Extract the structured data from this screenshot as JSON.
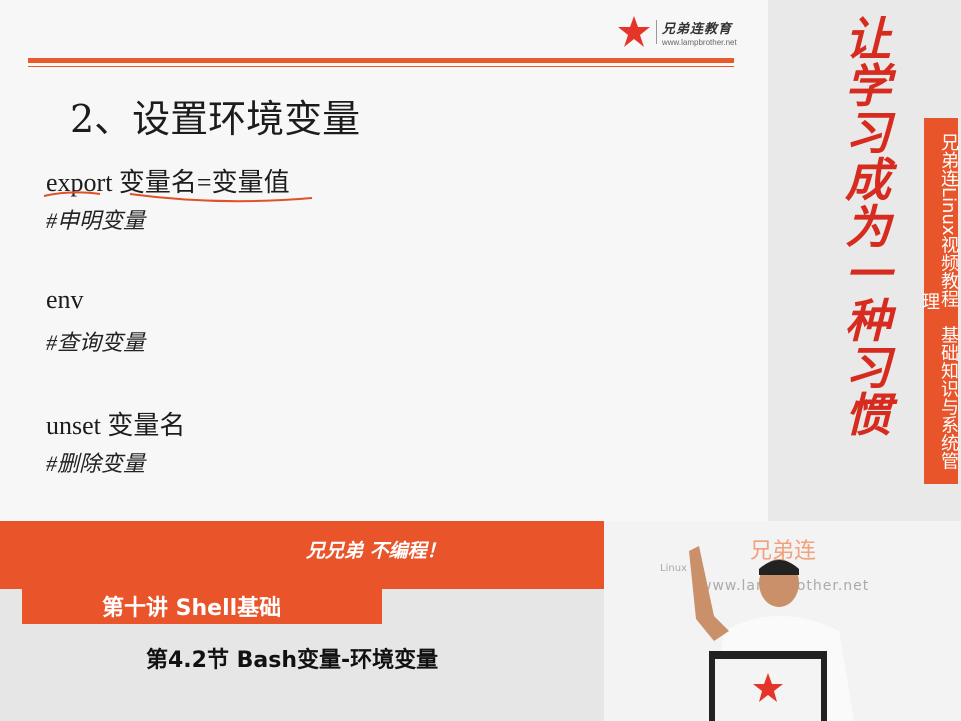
{
  "slide": {
    "logo": {
      "name": "兄弟连教育",
      "url": "www.lampbrother.net"
    },
    "title": "2、设置环境变量",
    "items": [
      {
        "command": "export 变量名=变量值",
        "comment": "#申明变量"
      },
      {
        "command": "env",
        "comment": "#查询变量"
      },
      {
        "command": "unset 变量名",
        "comment": "#删除变量"
      }
    ]
  },
  "sidebar": {
    "slogan": "让学习成为一种习惯",
    "vertical_text": "兄弟连Linux视频教程　基础知识与系统管理"
  },
  "banner": {
    "motto": "兄兄弟 不编程！",
    "lecture": "第十讲 Shell基础",
    "section": "第4.2节 Bash变量-环境变量"
  },
  "video": {
    "brand": "兄弟连",
    "watermark_url": "www.lampbrother.net",
    "watermark_small": "Linux"
  },
  "colors": {
    "accent": "#e9542a",
    "slogan": "#d62b1e"
  }
}
